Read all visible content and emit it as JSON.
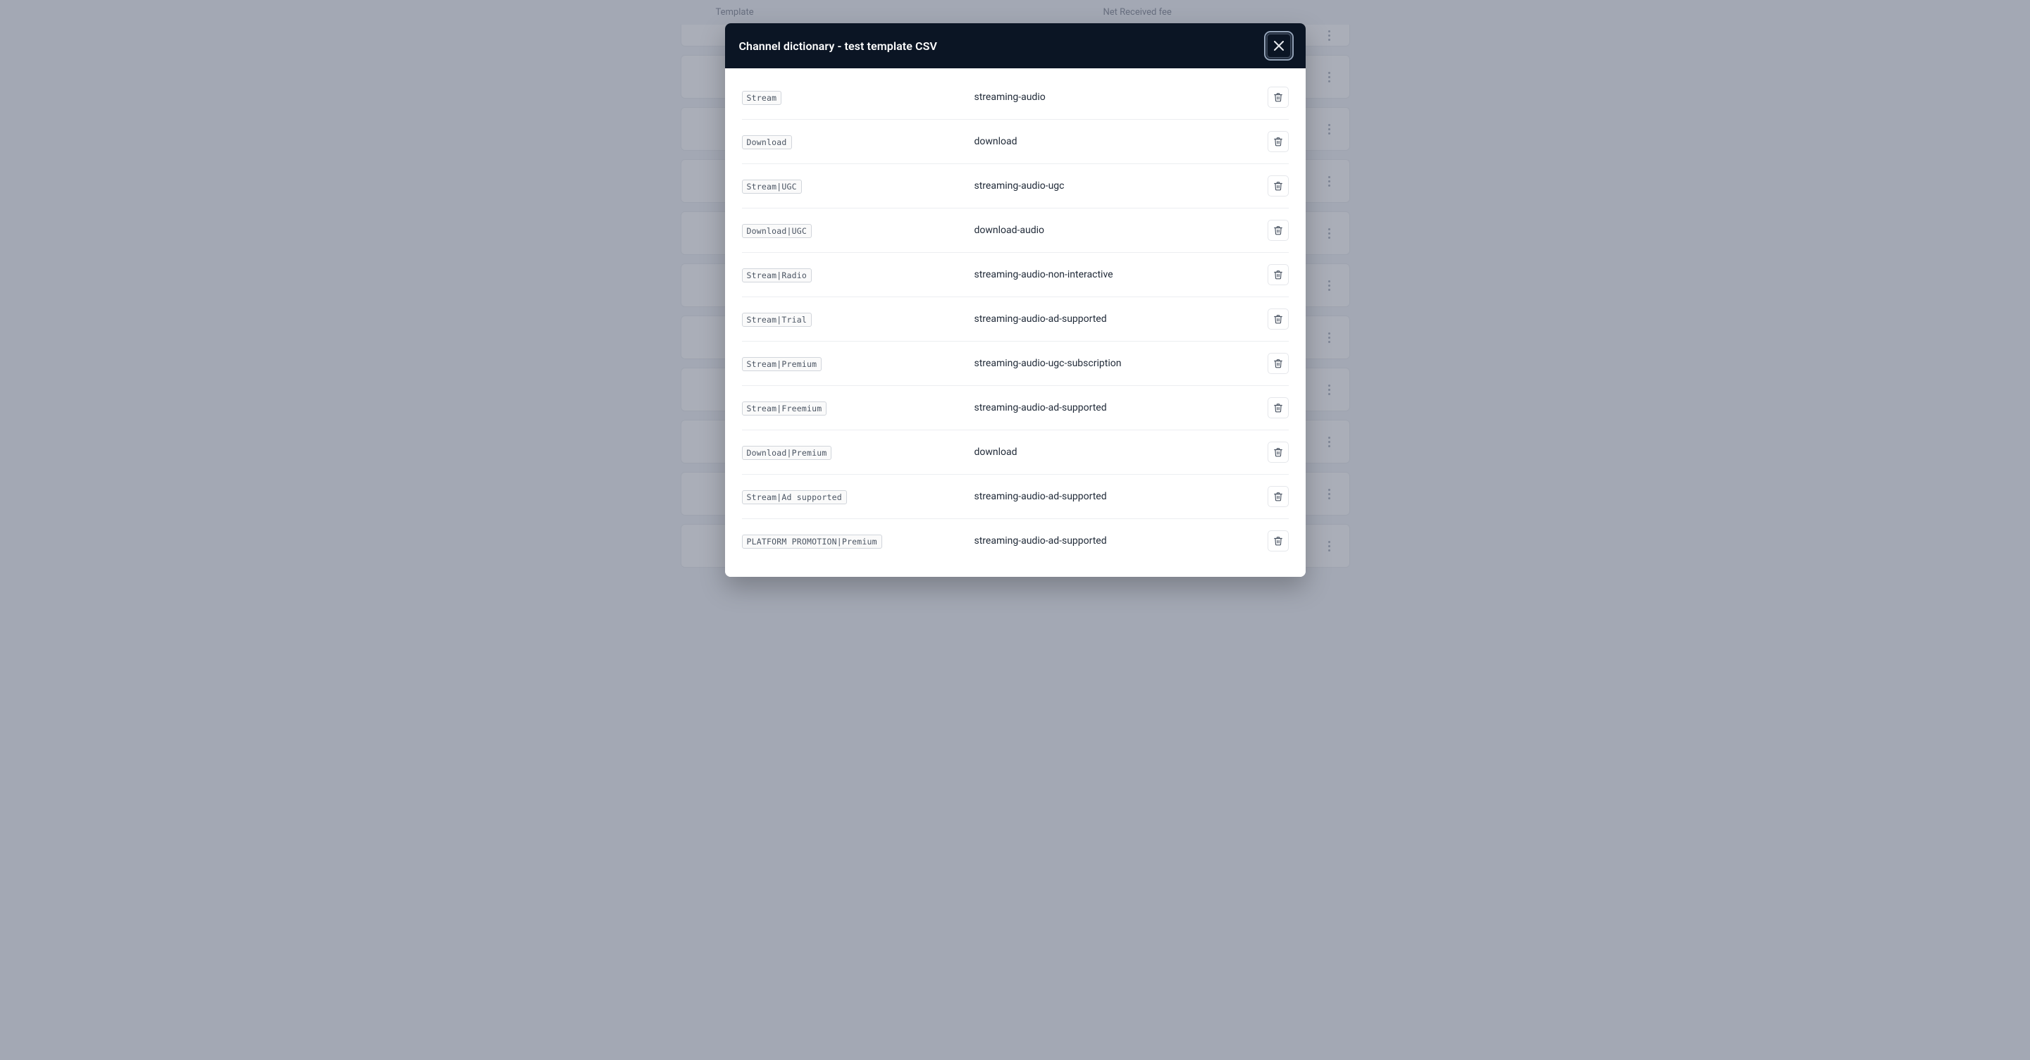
{
  "background": {
    "headers": {
      "template": "Template",
      "fee": "Net Received fee"
    },
    "row_count": 10
  },
  "modal": {
    "title": "Channel dictionary - test template CSV",
    "rows": [
      {
        "tag": "Stream",
        "value": "streaming-audio"
      },
      {
        "tag": "Download",
        "value": "download"
      },
      {
        "tag": "Stream|UGC",
        "value": "streaming-audio-ugc"
      },
      {
        "tag": "Download|UGC",
        "value": "download-audio"
      },
      {
        "tag": "Stream|Radio",
        "value": "streaming-audio-non-interactive"
      },
      {
        "tag": "Stream|Trial",
        "value": "streaming-audio-ad-supported"
      },
      {
        "tag": "Stream|Premium",
        "value": "streaming-audio-ugc-subscription"
      },
      {
        "tag": "Stream|Freemium",
        "value": "streaming-audio-ad-supported"
      },
      {
        "tag": "Download|Premium",
        "value": "download"
      },
      {
        "tag": "Stream|Ad supported",
        "value": "streaming-audio-ad-supported"
      },
      {
        "tag": "PLATFORM PROMOTION|Premium",
        "value": "streaming-audio-ad-supported"
      }
    ]
  }
}
